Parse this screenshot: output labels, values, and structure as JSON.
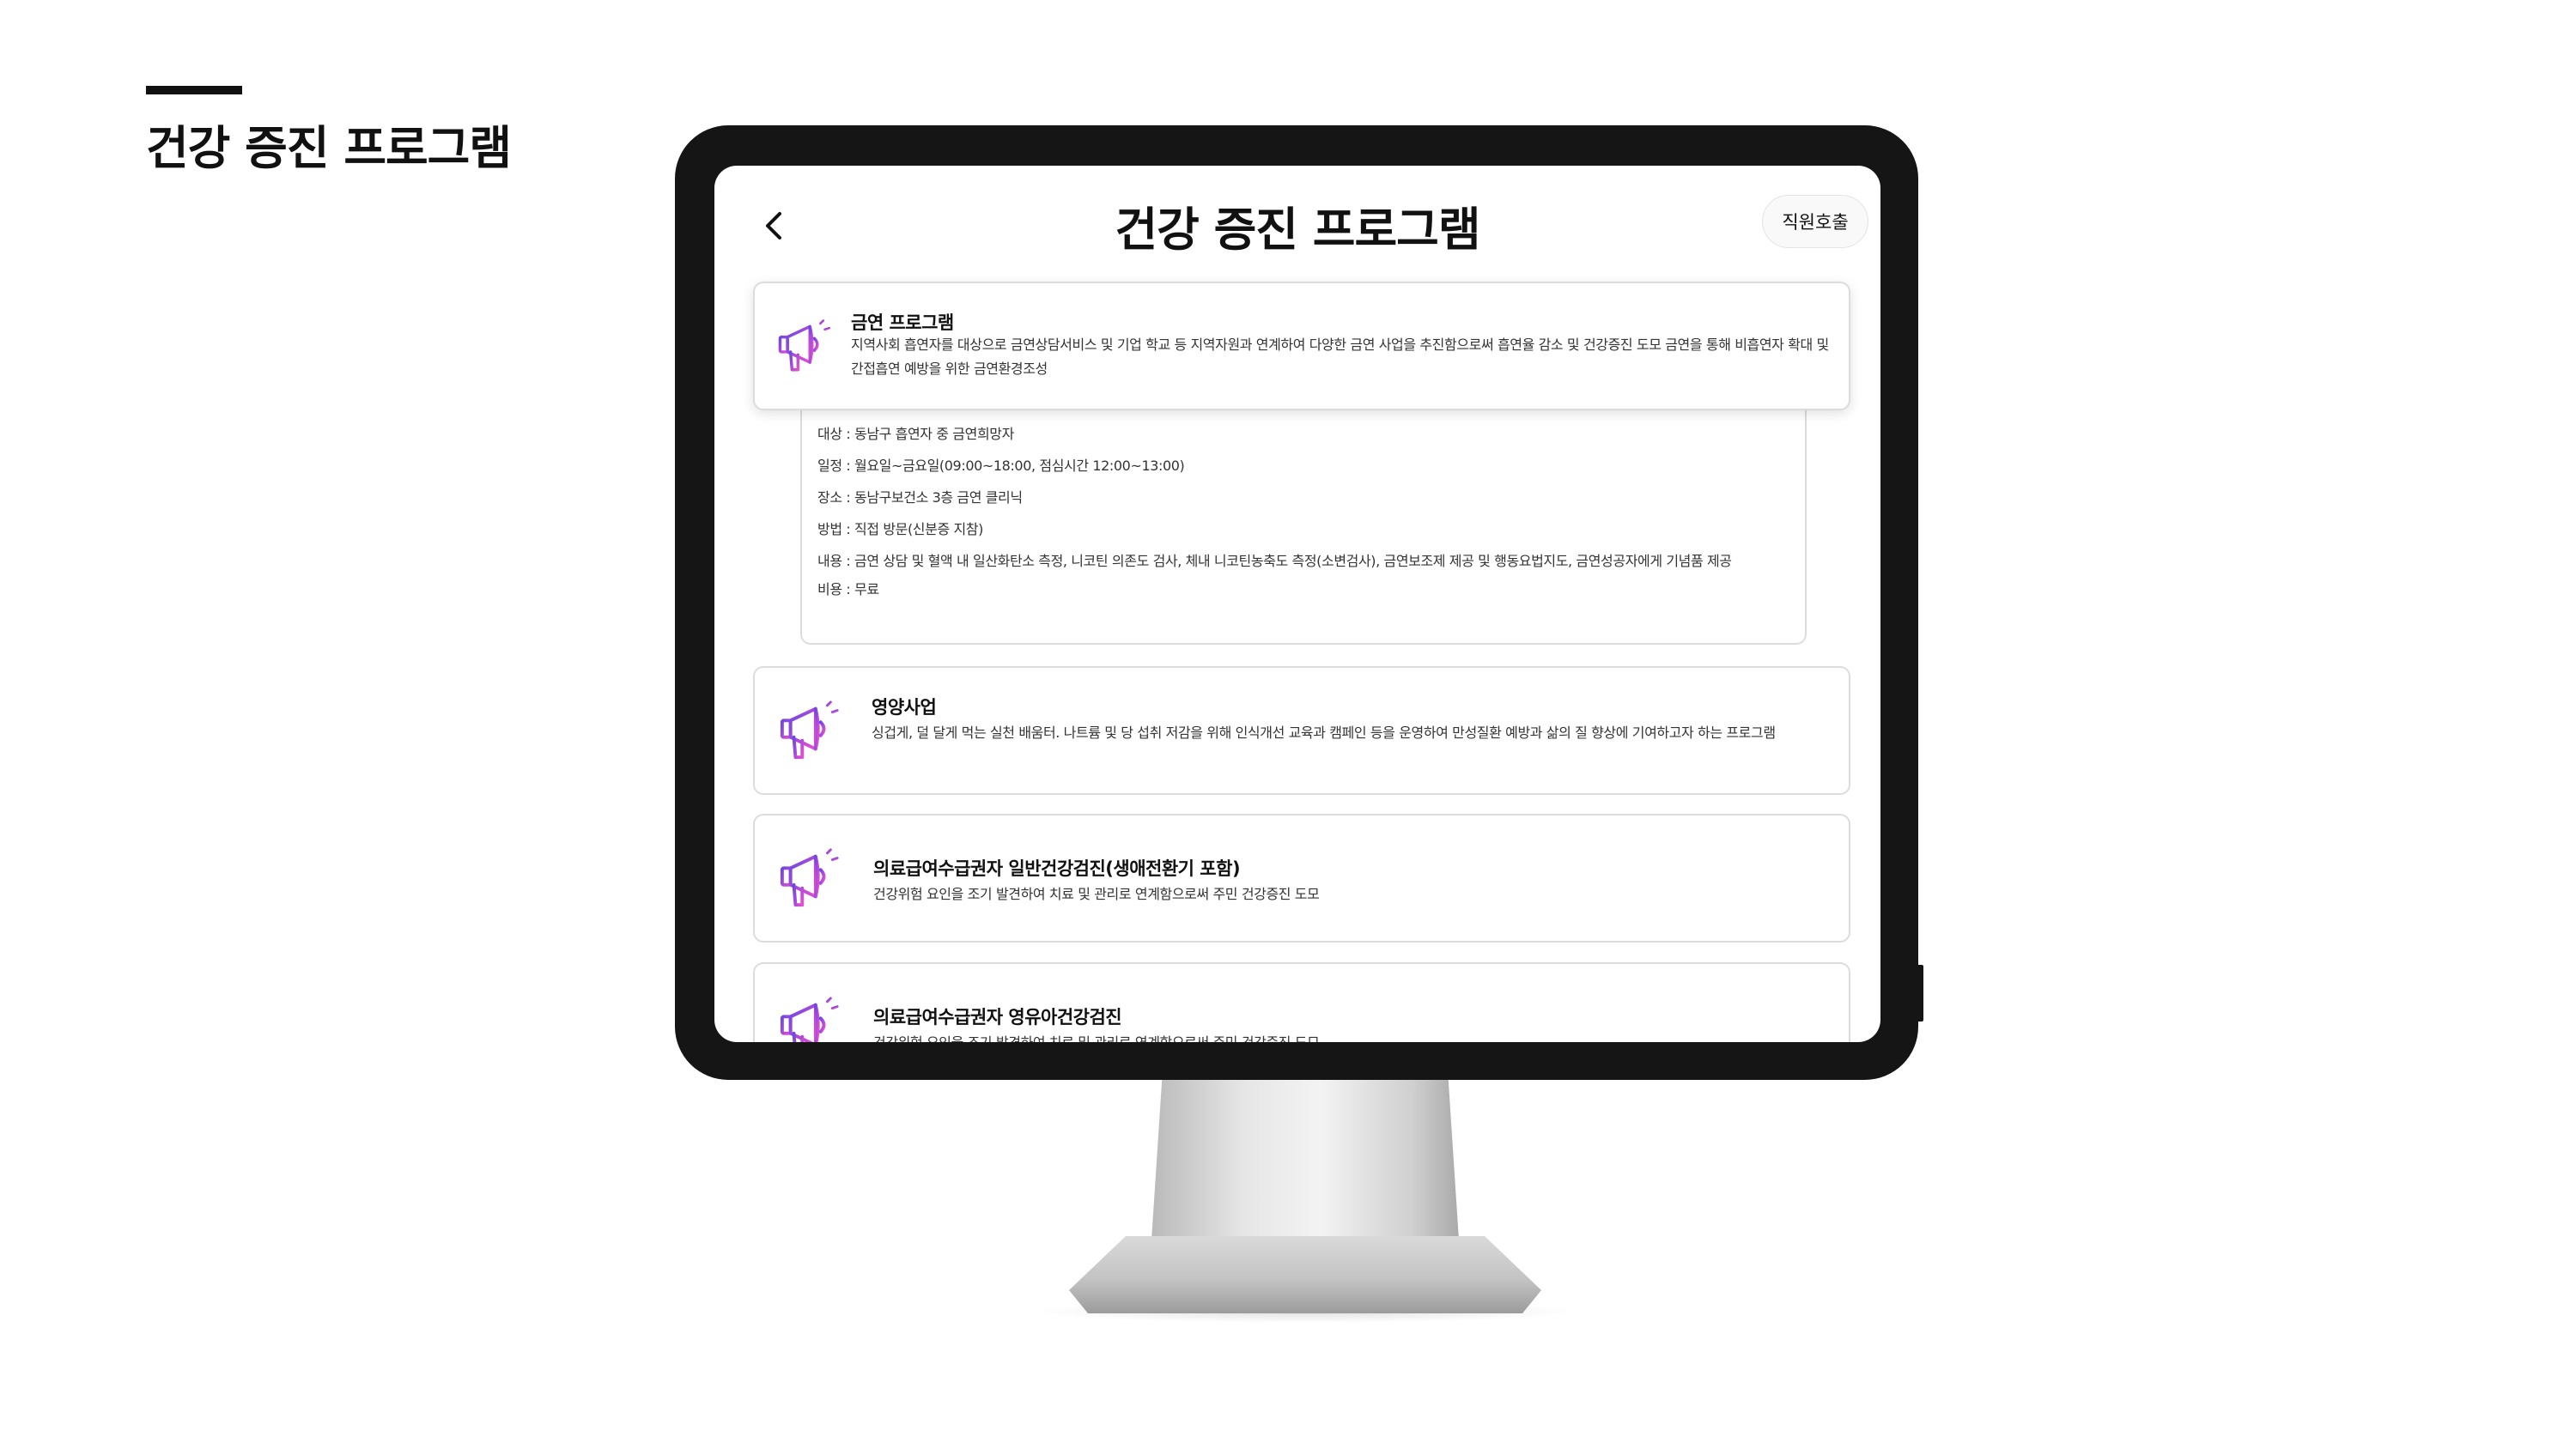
{
  "slide": {
    "title": "건강 증진 프로그램"
  },
  "app": {
    "title": "건강 증진 프로그램",
    "staff_call_label": "직원호출"
  },
  "programs": [
    {
      "title": "금연 프로그램",
      "description": "지역사회 흡연자를 대상으로 금연상담서비스 및 기업 학교 등 지역자원과 연계하여 다양한 금연 사업을 추진함으로써 흡연율 감소 및 건강증진 도모 금연을 통해 비흡연자 확대 및 간접흡연 예방을 위한 금연환경조성",
      "expanded": true,
      "details": [
        "대상 : 동남구 흡연자 중 금연희망자",
        "일정 : 월요일~금요일(09:00~18:00, 점심시간 12:00~13:00)",
        "장소 : 동남구보건소 3층 금연 클리닉",
        "방법 : 직접 방문(신분증 지참)",
        "내용 : 금연 상담 및 혈액 내 일산화탄소 측정, 니코틴 의존도 검사, 체내 니코틴농축도 측정(소변검사), 금연보조제 제공 및 행동요법지도, 금연성공자에게 기념품 제공",
        "비용 : 무료"
      ]
    },
    {
      "title": "영양사업",
      "description": "싱겁게, 덜 달게 먹는 실천 배움터. 나트륨 및 당 섭취 저감을 위해 인식개선 교육과 캠페인 등을 운영하여 만성질환 예방과 삶의 질 향상에 기여하고자 하는 프로그램",
      "expanded": false
    },
    {
      "title": "의료급여수급권자 일반건강검진(생애전환기 포함)",
      "description": "건강위험 요인을 조기 발견하여 치료 및 관리로 연계함으로써 주민 건강증진 도모",
      "expanded": false
    },
    {
      "title": "의료급여수급권자 영유아건강검진",
      "description": "건강위험 요인을 조기 발견하여 치료 및 관리로 연계함으로써 주민 건강증진 도모",
      "expanded": false
    }
  ],
  "colors": {
    "icon_gradient_start": "#6b46e5",
    "icon_gradient_end": "#e64fcf",
    "bezel": "#151515"
  }
}
